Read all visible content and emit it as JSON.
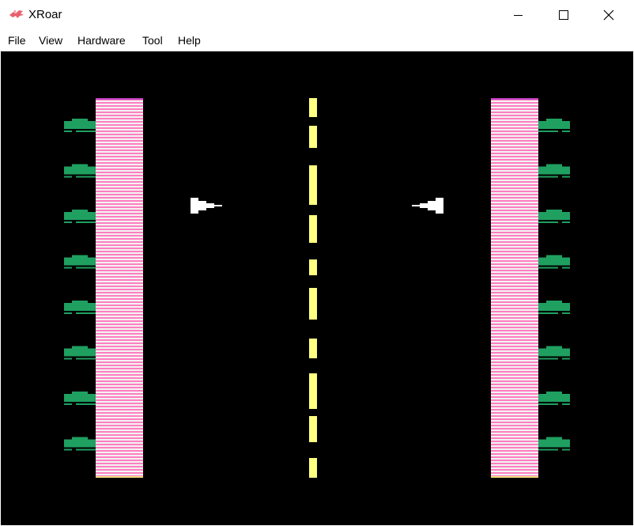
{
  "window": {
    "title": "XRoar",
    "app_icon": "xroar-dragon-icon",
    "controls": {
      "minimize_icon": "minimize-icon",
      "maximize_icon": "maximize-icon",
      "close_icon": "close-icon"
    }
  },
  "menubar": {
    "items": [
      "File",
      "View",
      "Hardware",
      "Tool",
      "Help"
    ]
  },
  "screen": {
    "background": "#000000",
    "colors": {
      "wall_pink": "#ff7ec1",
      "wall_stripe": "#f2f2f2",
      "tank_green": "#1fa061",
      "centre_line": "#ffff80",
      "ship": "#ffffff"
    },
    "left_wall_tanks": 8,
    "right_wall_tanks": 8,
    "left_ship_icon": "player-ship-right-icon",
    "right_ship_icon": "player-ship-left-icon"
  }
}
